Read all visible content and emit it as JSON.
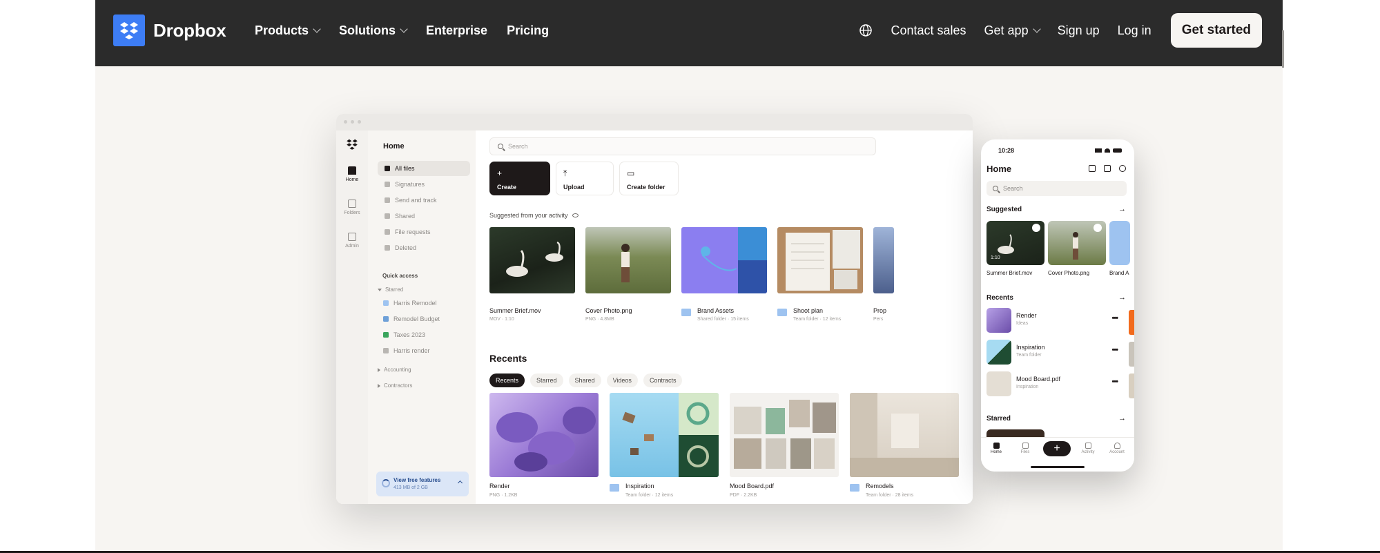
{
  "nav": {
    "brand": "Dropbox",
    "items": [
      {
        "label": "Products",
        "dropdown": true
      },
      {
        "label": "Solutions",
        "dropdown": true
      },
      {
        "label": "Enterprise",
        "dropdown": false
      },
      {
        "label": "Pricing",
        "dropdown": false
      }
    ],
    "right": {
      "language_icon": "globe-icon",
      "contact_sales": "Contact sales",
      "get_app": "Get app",
      "sign_up": "Sign up",
      "log_in": "Log in",
      "cta": "Get started"
    },
    "colors": {
      "bar": "#2b2b2b",
      "brand_blue": "#3d7df5",
      "cta_bg": "#f7f5f2"
    }
  },
  "desktop": {
    "rail": [
      {
        "label": "Home",
        "icon": "home-icon"
      },
      {
        "label": "Folders",
        "icon": "folder-icon"
      },
      {
        "label": "Admin",
        "icon": "admin-icon"
      }
    ],
    "sidebar": {
      "title": "Home",
      "items": [
        "All files",
        "Signatures",
        "Send and track",
        "Shared",
        "File requests",
        "Deleted"
      ],
      "quick_access": "Quick access",
      "starred": "Starred",
      "starred_files": [
        {
          "name": "Harris Remodel",
          "color": "#9ec3f0"
        },
        {
          "name": "Remodel Budget",
          "color": "#6ea0d8"
        },
        {
          "name": "Taxes 2023",
          "color": "#3aa55d"
        },
        {
          "name": "Harris render",
          "color": "#b9b6b2"
        }
      ],
      "accounting": "Accounting",
      "contractors": "Contractors",
      "free_features": "View free features",
      "free_usage": "413 MB of 2 GB"
    },
    "search_placeholder": "Search",
    "actions": [
      "Create",
      "Upload",
      "Create folder"
    ],
    "suggested_label": "Suggested from your activity",
    "suggested": [
      {
        "name": "Summer Brief.mov",
        "meta": "MOV · 1:10"
      },
      {
        "name": "Cover Photo.png",
        "meta": "PNG · 4.8MB"
      },
      {
        "name": "Brand Assets",
        "meta": "Shared folder · 15 items"
      },
      {
        "name": "Shoot plan",
        "meta": "Team folder · 12 items"
      },
      {
        "name": "Prop",
        "meta": "Pers"
      }
    ],
    "recents_title": "Recents",
    "filters": [
      "Recents",
      "Starred",
      "Shared",
      "Videos",
      "Contracts"
    ],
    "recents": [
      {
        "name": "Render",
        "meta": "PNG · 1.2KB"
      },
      {
        "name": "Inspiration",
        "meta": "Team folder · 12 items"
      },
      {
        "name": "Mood Board.pdf",
        "meta": "PDF · 2.2KB"
      },
      {
        "name": "Remodels",
        "meta": "Team folder · 28 items"
      }
    ]
  },
  "phone": {
    "time": "10:28",
    "title": "Home",
    "search_placeholder": "Search",
    "suggested": "Suggested",
    "suggested_items": [
      "Summer Brief.mov",
      "Cover Photo.png",
      "Brand A"
    ],
    "video_duration": "1:10",
    "recents": "Recents",
    "recent_items": [
      {
        "name": "Render",
        "meta": "Ideas"
      },
      {
        "name": "Inspiration",
        "meta": "Team folder"
      },
      {
        "name": "Mood Board.pdf",
        "meta": "Inspiration"
      }
    ],
    "starred": "Starred",
    "tabs": [
      "Home",
      "Files",
      "Activity",
      "Account"
    ]
  }
}
